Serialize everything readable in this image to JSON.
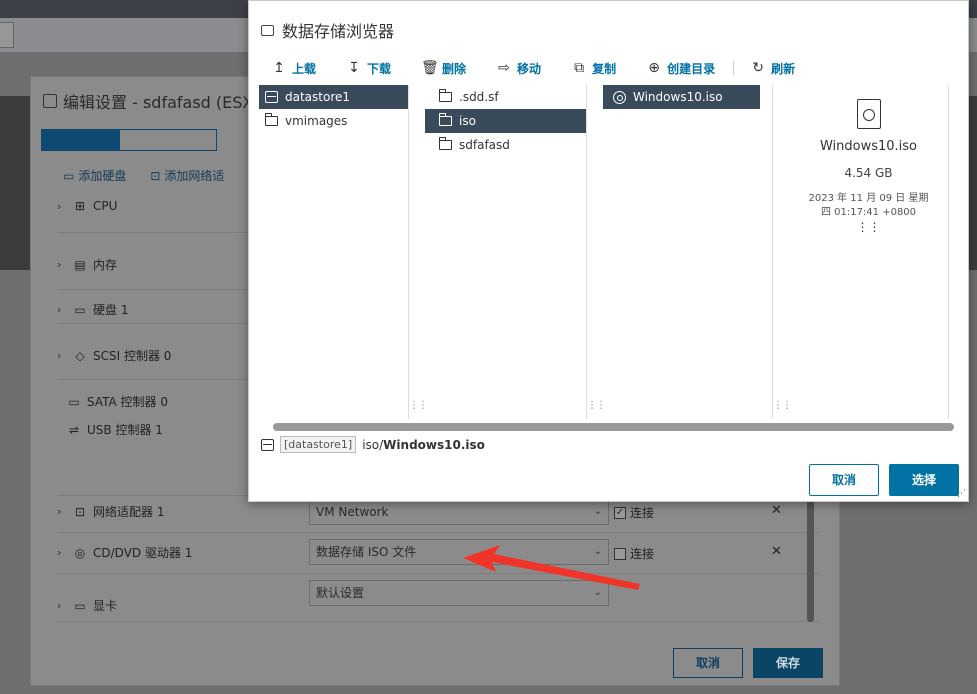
{
  "edit_dialog": {
    "title": "编辑设置 - sdfafasd (ESX",
    "actions": {
      "add_disk": "添加硬盘",
      "add_nic": "添加网络适"
    },
    "hardware": [
      {
        "label": "CPU",
        "icon": "cpu-icon"
      },
      {
        "label": "内存",
        "icon": "memory-icon"
      },
      {
        "label": "硬盘 1",
        "icon": "disk-icon"
      },
      {
        "label": "SCSI 控制器 0",
        "icon": "scsi-icon"
      },
      {
        "label": "SATA 控制器 0",
        "icon": "sata-icon"
      },
      {
        "label": "USB 控制器 1",
        "icon": "usb-icon"
      },
      {
        "label": "网络适配器 1",
        "icon": "network-icon"
      },
      {
        "label": "CD/DVD 驱动器 1",
        "icon": "cd-icon"
      },
      {
        "label": "显卡",
        "icon": "monitor-icon"
      }
    ],
    "fields": {
      "network": "VM Network",
      "cd_source": "数据存储 ISO 文件",
      "display": "默认设置"
    },
    "connect_label": "连接",
    "network_connected": true,
    "cd_connected": false,
    "cancel": "取消",
    "save": "保存"
  },
  "browser": {
    "title": "数据存储浏览器",
    "toolbar": {
      "upload": "上载",
      "download": "下载",
      "delete": "删除",
      "move": "移动",
      "copy": "复制",
      "mkdir": "创建目录",
      "refresh": "刷新"
    },
    "col1": [
      "datastore1",
      "vmimages"
    ],
    "col2": [
      ".sdd.sf",
      "iso",
      "sdfafasd"
    ],
    "col3": [
      "Windows10.iso"
    ],
    "preview": {
      "name": "Windows10.iso",
      "size": "4.54 GB",
      "date": "2023 年 11 月 09 日 星期四 01:17:41 +0800"
    },
    "path": {
      "datastore": "[datastore1]",
      "dir": "iso/",
      "file": "Windows10.iso"
    },
    "cancel": "取消",
    "select": "选择"
  },
  "colors": {
    "accent": "#0072a3",
    "selected": "#394b5b",
    "arrow": "#f0342a"
  }
}
